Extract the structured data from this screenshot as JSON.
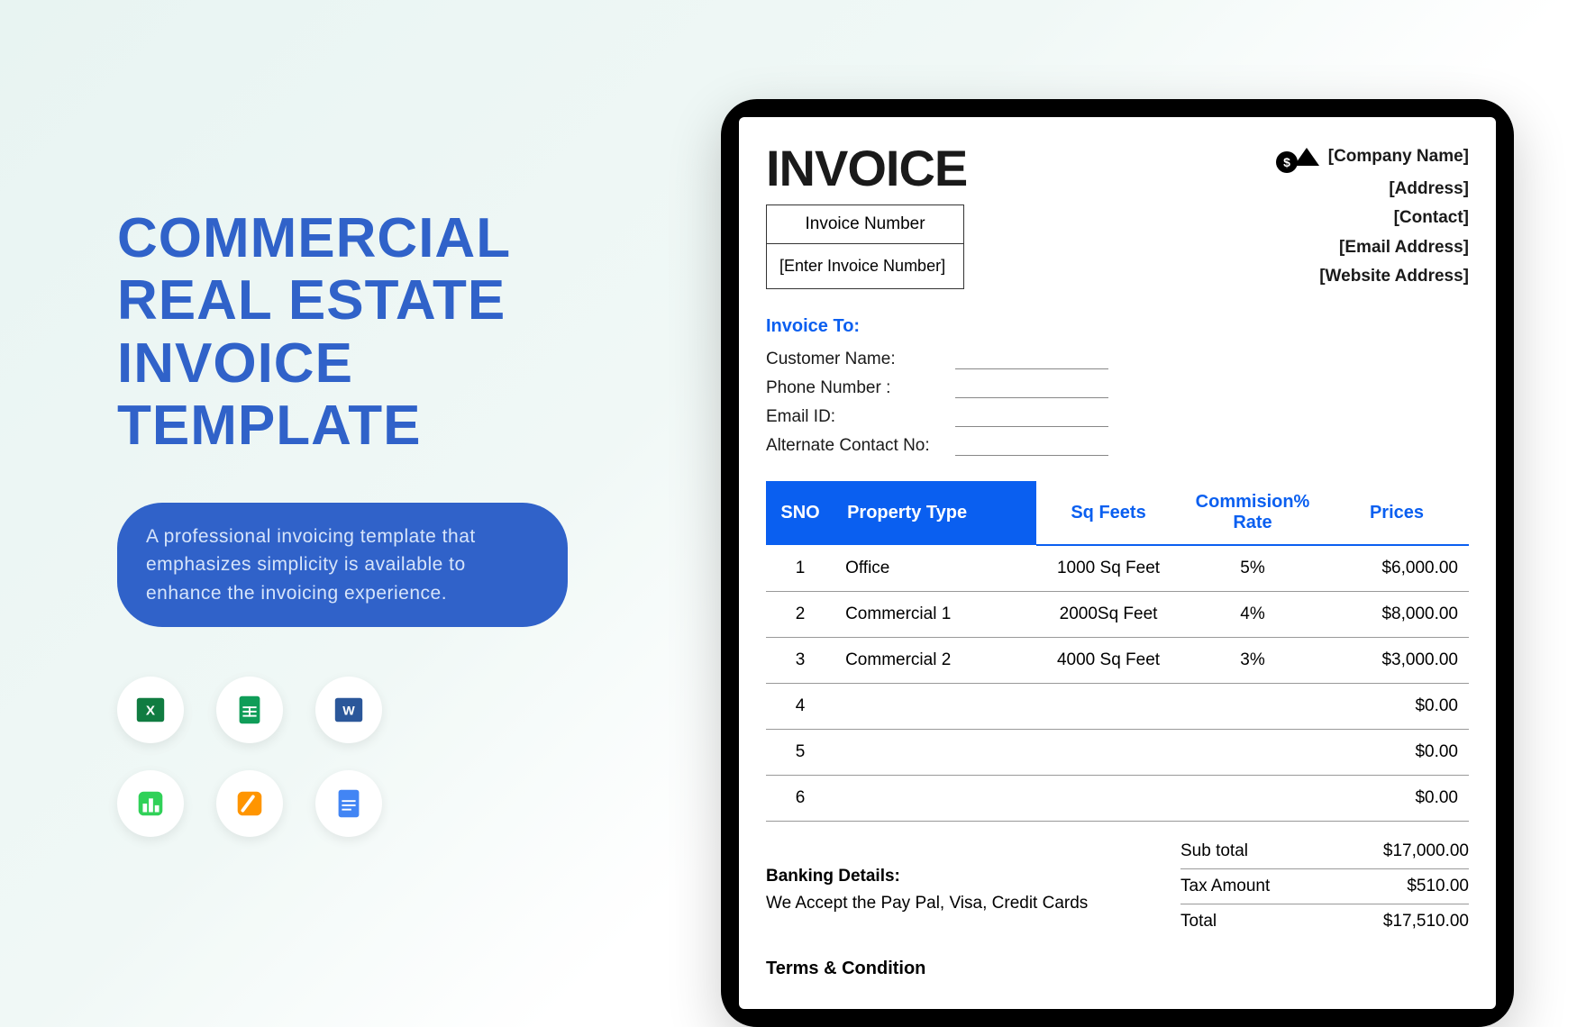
{
  "page": {
    "title_line1": "COMMERCIAL",
    "title_line2": "REAL ESTATE",
    "title_line3": "INVOICE",
    "title_line4": "TEMPLATE",
    "description": "A professional invoicing template that emphasizes simplicity is available to enhance the invoicing experience."
  },
  "apps": [
    {
      "name": "excel-icon"
    },
    {
      "name": "sheets-icon"
    },
    {
      "name": "word-icon"
    },
    {
      "name": "numbers-icon"
    },
    {
      "name": "pages-icon"
    },
    {
      "name": "docs-icon"
    }
  ],
  "invoice": {
    "heading": "INVOICE",
    "company": {
      "name": "[Company Name]",
      "address": "[Address]",
      "contact": "[Contact]",
      "email": "[Email Address]",
      "website": "[Website Address]"
    },
    "number_box": {
      "label": "Invoice Number",
      "placeholder": "[Enter Invoice Number]"
    },
    "invoice_to_label": "Invoice To:",
    "fields": {
      "customer_name": "Customer Name:",
      "phone": "Phone Number :",
      "email": "Email ID:",
      "alt_contact": "Alternate Contact No:"
    },
    "table": {
      "headers": {
        "sno": "SNO",
        "property_type": "Property Type",
        "sqfeets": "Sq Feets",
        "commission": "Commision% Rate",
        "prices": "Prices"
      },
      "rows": [
        {
          "sno": "1",
          "type": "Office",
          "sqft": "1000  Sq Feet",
          "comm": "5%",
          "price": "$6,000.00"
        },
        {
          "sno": "2",
          "type": "Commercial 1",
          "sqft": "2000Sq Feet",
          "comm": "4%",
          "price": "$8,000.00"
        },
        {
          "sno": "3",
          "type": "Commercial 2",
          "sqft": "4000 Sq Feet",
          "comm": "3%",
          "price": "$3,000.00"
        },
        {
          "sno": "4",
          "type": "",
          "sqft": "",
          "comm": "",
          "price": "$0.00"
        },
        {
          "sno": "5",
          "type": "",
          "sqft": "",
          "comm": "",
          "price": "$0.00"
        },
        {
          "sno": "6",
          "type": "",
          "sqft": "",
          "comm": "",
          "price": "$0.00"
        }
      ]
    },
    "totals": {
      "subtotal_label": "Sub total",
      "subtotal_value": "$17,000.00",
      "tax_label": "Tax Amount",
      "tax_value": "$510.00",
      "total_label": "Total",
      "total_value": "$17,510.00"
    },
    "banking": {
      "title": "Banking Details:",
      "text": "We Accept the  Pay Pal, Visa, Credit Cards"
    },
    "terms_heading": "Terms & Condition"
  }
}
